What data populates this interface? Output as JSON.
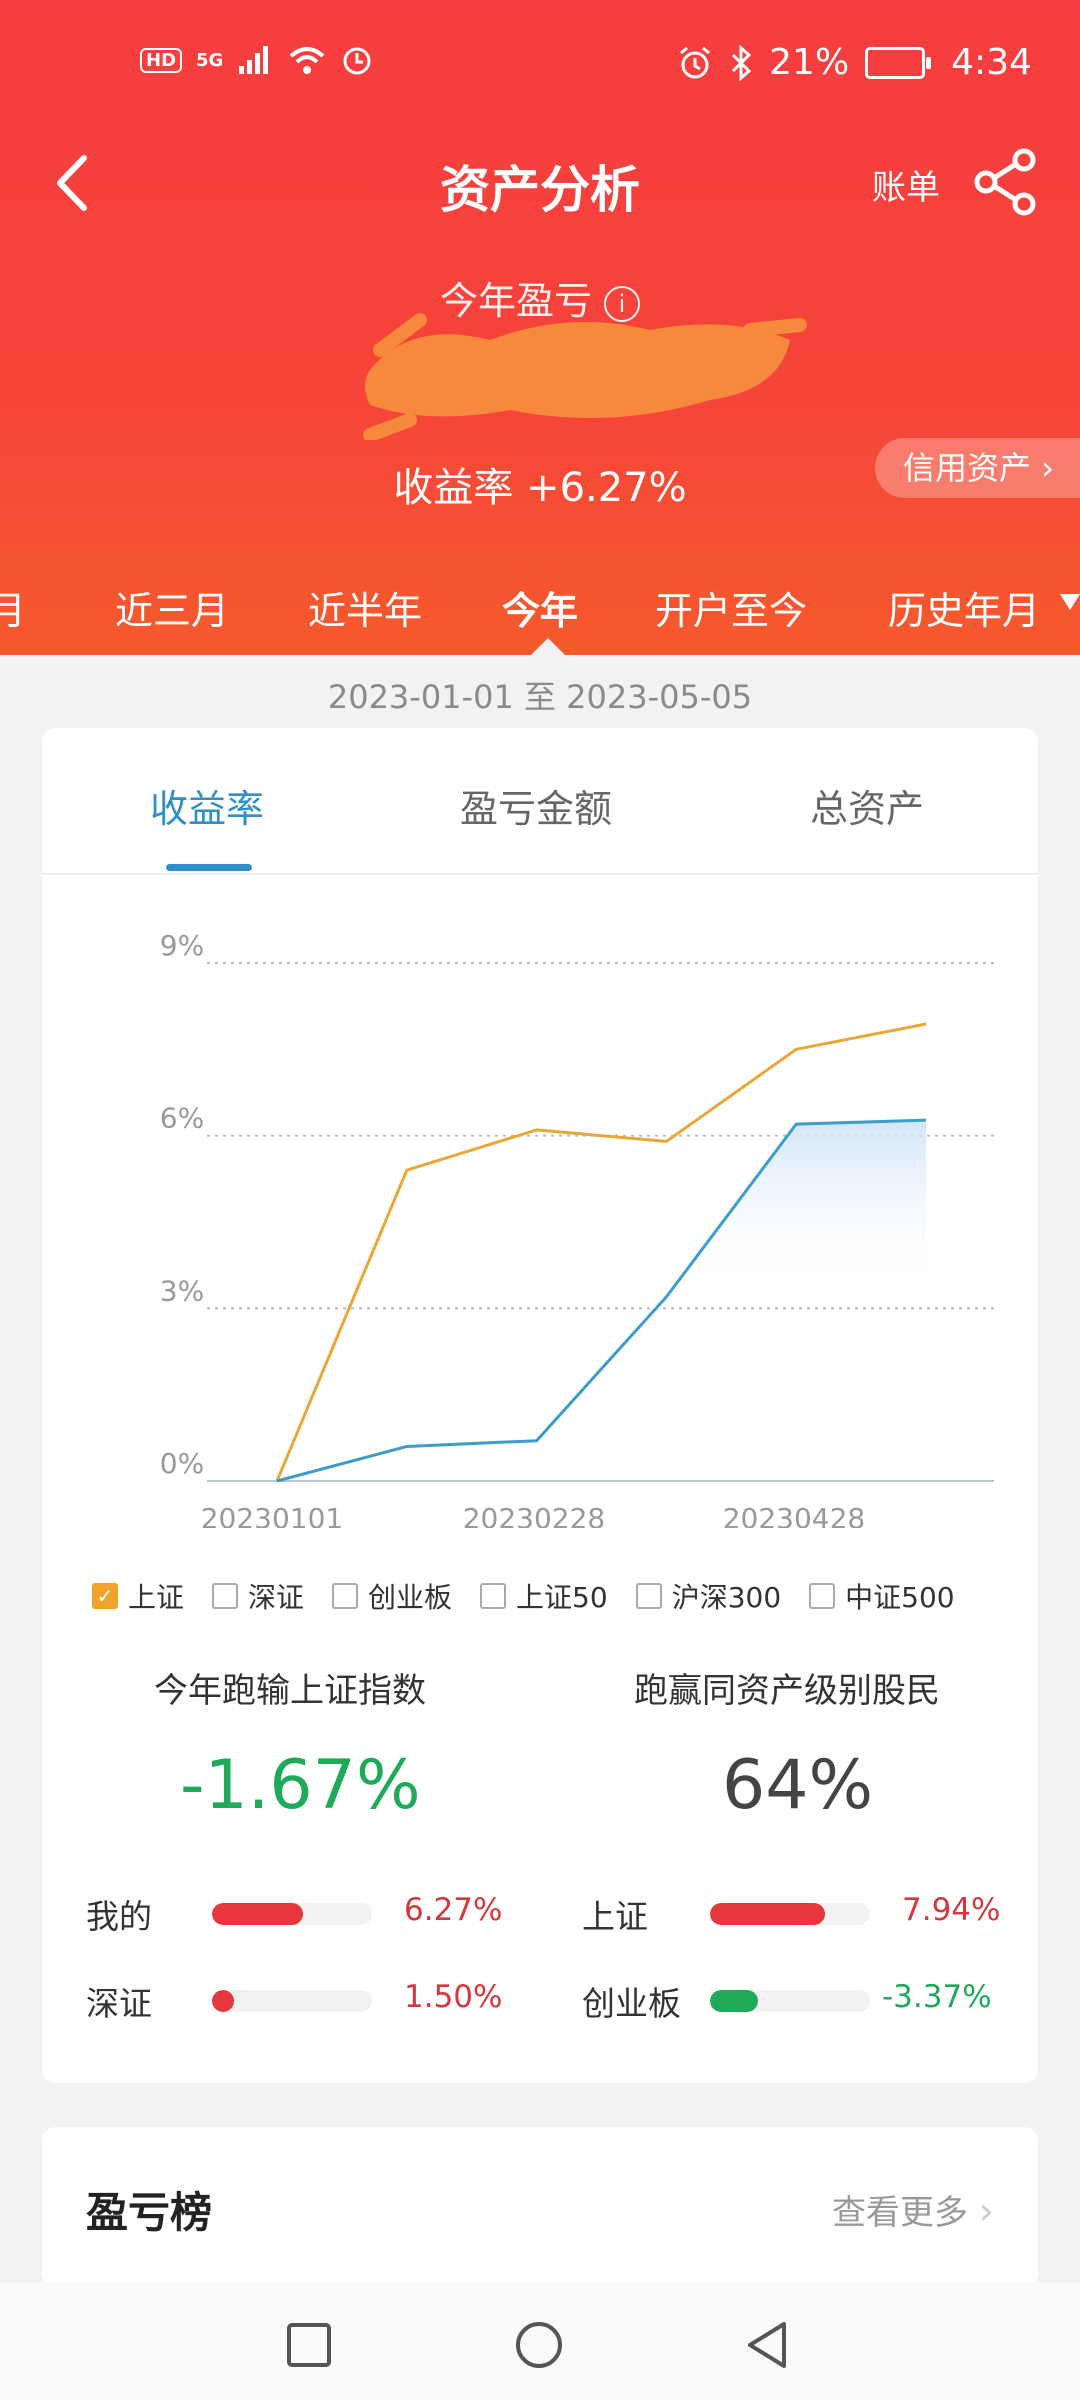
{
  "status_bar": {
    "hd": "HD",
    "network": "5G",
    "battery_pct": "21%",
    "time": "4:34"
  },
  "nav": {
    "title": "资产分析",
    "bill": "账单"
  },
  "summary": {
    "pl_label": "今年盈亏",
    "info_symbol": "i",
    "return_label": "收益率 +6.27%",
    "credit_button": "信用资产"
  },
  "period_tabs": [
    {
      "label": "月"
    },
    {
      "label": "近三月"
    },
    {
      "label": "近半年"
    },
    {
      "label": "今年"
    },
    {
      "label": "开户至今"
    },
    {
      "label": "历史年月"
    }
  ],
  "active_period": "今年",
  "date_range": "2023-01-01 至 2023-05-05",
  "segments": [
    {
      "label": "收益率"
    },
    {
      "label": "盈亏金额"
    },
    {
      "label": "总资产"
    }
  ],
  "active_segment": "收益率",
  "chart_data": {
    "type": "line",
    "y_ticks": [
      "9%",
      "6%",
      "3%",
      "0%"
    ],
    "ylim": [
      0,
      9
    ],
    "x_ticks": [
      "20230101",
      "20230228",
      "20230428"
    ],
    "x": [
      "20230101",
      "20230201",
      "20230301",
      "20230401",
      "20230501",
      "20230505"
    ],
    "series": [
      {
        "name": "上证",
        "color": "#e8a736",
        "values": [
          0,
          5.4,
          6.1,
          5.9,
          7.5,
          7.94
        ]
      },
      {
        "values": [
          0,
          0.6,
          0.7,
          3.2,
          6.2,
          6.27
        ],
        "color": "#3d9cc9"
      }
    ],
    "grid": true
  },
  "legend": [
    {
      "label": "上证",
      "checked": true
    },
    {
      "label": "深证",
      "checked": false
    },
    {
      "label": "创业板",
      "checked": false
    },
    {
      "label": "上证50",
      "checked": false
    },
    {
      "label": "沪深300",
      "checked": false
    },
    {
      "label": "中证500",
      "checked": false
    }
  ],
  "compare": {
    "left_title": "今年跑输上证指数",
    "left_value": "-1.67%",
    "right_title": "跑赢同资产级别股民",
    "right_value": "64%"
  },
  "bars": [
    {
      "label": "我的",
      "value": "6.27%",
      "fraction": 0.57,
      "color": "#e5373d"
    },
    {
      "label": "上证",
      "value": "7.94%",
      "fraction": 0.72,
      "color": "#e5373d"
    },
    {
      "label": "深证",
      "value": "1.50%",
      "fraction": 0.14,
      "color": "#e5373d"
    },
    {
      "label": "创业板",
      "value": "-3.37%",
      "fraction": 0.3,
      "color": "#1faa59"
    }
  ],
  "ranking": {
    "title": "盈亏榜",
    "more": "查看更多"
  }
}
